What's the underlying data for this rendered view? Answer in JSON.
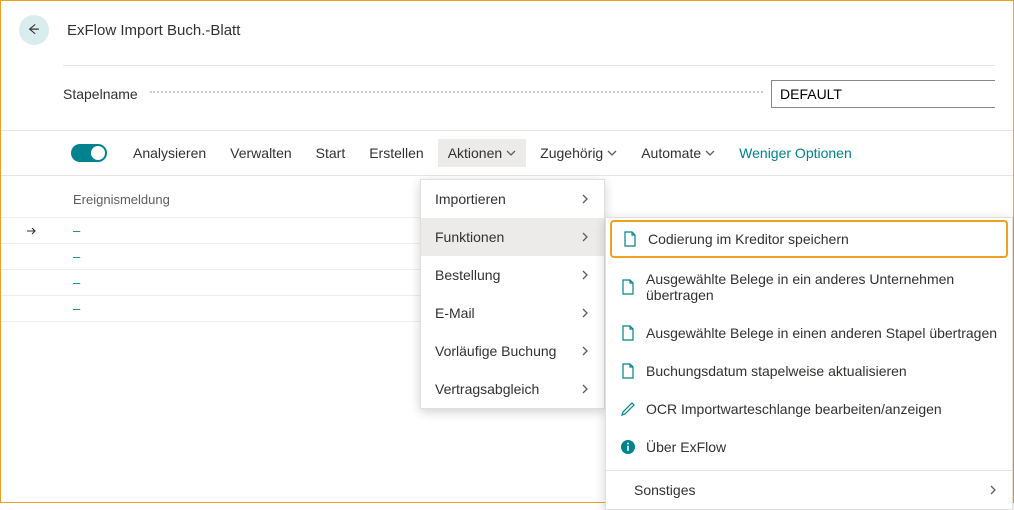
{
  "header": {
    "title": "ExFlow Import Buch.-Blatt"
  },
  "field": {
    "label": "Stapelname",
    "value": "DEFAULT"
  },
  "toolbar": {
    "analyze": "Analysieren",
    "manage": "Verwalten",
    "start": "Start",
    "create": "Erstellen",
    "actions": "Aktionen",
    "related": "Zugehörig",
    "automate": "Automate",
    "less": "Weniger Optionen"
  },
  "columns": {
    "event": "Ereignismeldung"
  },
  "rows": [
    {
      "link": "–"
    },
    {
      "link": "–"
    },
    {
      "link": "–"
    },
    {
      "link": "–"
    }
  ],
  "menu1": {
    "import": "Importieren",
    "functions": "Funktionen",
    "order": "Bestellung",
    "email": "E-Mail",
    "prelim": "Vorläufige Buchung",
    "contract": "Vertragsabgleich"
  },
  "menu2": {
    "save_coding": "Codierung im Kreditor speichern",
    "move_company": "Ausgewählte Belege in ein anderes Unternehmen übertragen",
    "move_batch": "Ausgewählte Belege in einen anderen Stapel übertragen",
    "update_date": "Buchungsdatum stapelweise aktualisieren",
    "ocr_queue": "OCR Importwarteschlange bearbeiten/anzeigen",
    "about": "Über ExFlow",
    "other": "Sonstiges"
  }
}
